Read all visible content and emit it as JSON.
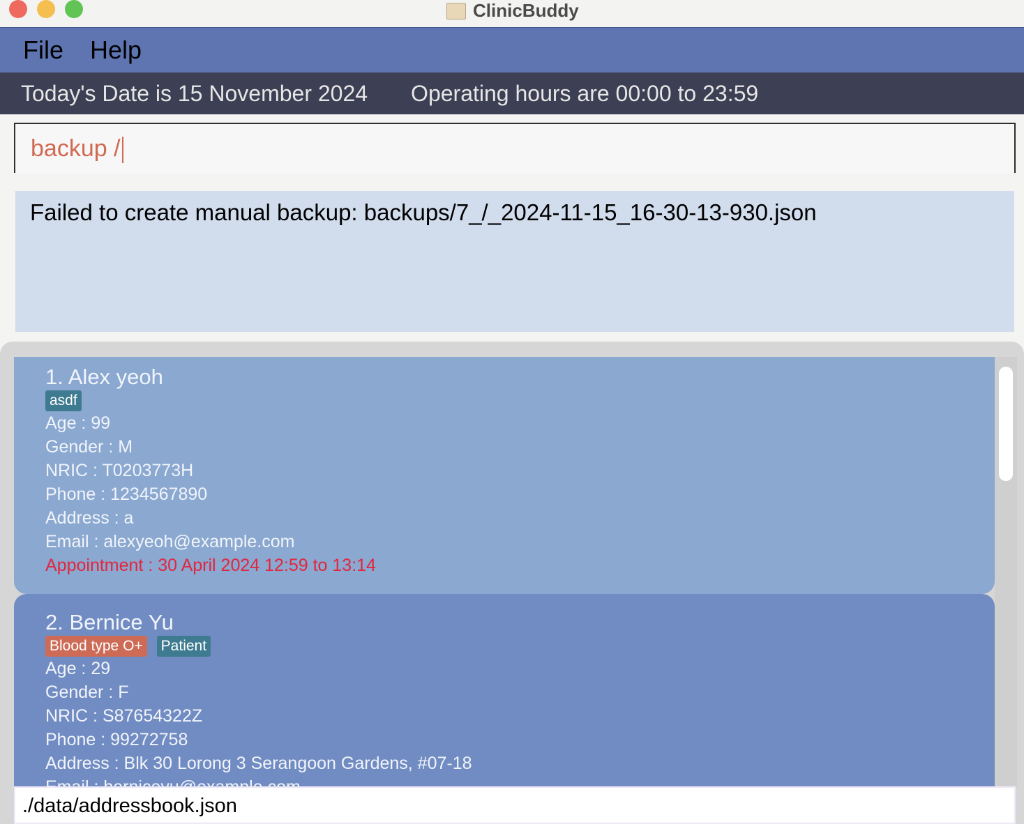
{
  "window": {
    "title": "ClinicBuddy"
  },
  "menu": {
    "items": [
      "File",
      "Help"
    ]
  },
  "status": {
    "date": "Today's Date is 15 November 2024",
    "hours": "Operating hours are 00:00 to 23:59"
  },
  "command": {
    "value": "backup /"
  },
  "result": {
    "message": "Failed to create manual backup: backups/7_/_2024-11-15_16-30-13-930.json"
  },
  "persons": [
    {
      "name": "1. Alex yeoh",
      "tags": [
        {
          "label": "asdf",
          "color": "#3e7b91"
        }
      ],
      "age": "Age : 99",
      "gender": "Gender : M",
      "nric": "NRIC : T0203773H",
      "phone": "Phone : 1234567890",
      "address": "Address : a",
      "email": "Email : alexyeoh@example.com",
      "appointment": "Appointment : 30 April 2024 12:59 to 13:14",
      "card_color": "#8aa8d0"
    },
    {
      "name": "2. Bernice Yu",
      "tags": [
        {
          "label": "Blood type O+",
          "color": "#cd6b57"
        },
        {
          "label": "Patient",
          "color": "#3e7b91"
        }
      ],
      "age": "Age : 29",
      "gender": "Gender : F",
      "nric": "NRIC : S87654322Z",
      "phone": "Phone : 99272758",
      "address": "Address : Blk 30 Lorong 3 Serangoon Gardens, #07-18",
      "email": "Email : berniceyu@example.com",
      "card_color": "#718cc2"
    }
  ],
  "footer": {
    "path": "./data/addressbook.json"
  }
}
